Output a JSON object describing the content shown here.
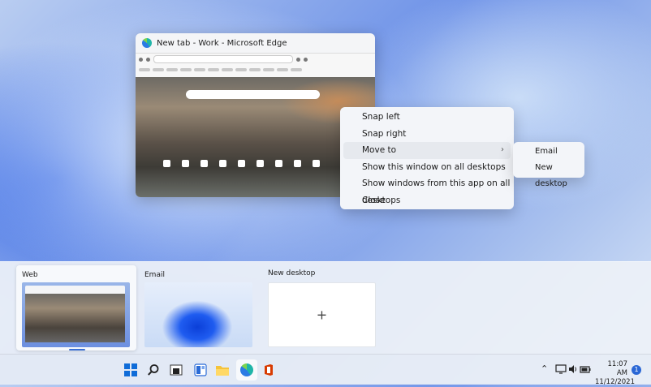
{
  "window": {
    "title": "New tab - Work - Microsoft Edge"
  },
  "context_menu": {
    "items": [
      {
        "label": "Snap left"
      },
      {
        "label": "Snap right"
      },
      {
        "label": "Move to"
      },
      {
        "label": "Show this window on all desktops"
      },
      {
        "label": "Show windows from this app on all desktops"
      },
      {
        "label": "Close"
      }
    ],
    "submenu": [
      {
        "label": "Email"
      },
      {
        "label": "New desktop"
      }
    ]
  },
  "desktops": [
    {
      "label": "Web"
    },
    {
      "label": "Email"
    },
    {
      "label": "New desktop"
    }
  ],
  "taskbar": {
    "time": "11:07 AM",
    "date": "11/12/2021",
    "notifications": "1",
    "accent": "#0f6cd8"
  }
}
